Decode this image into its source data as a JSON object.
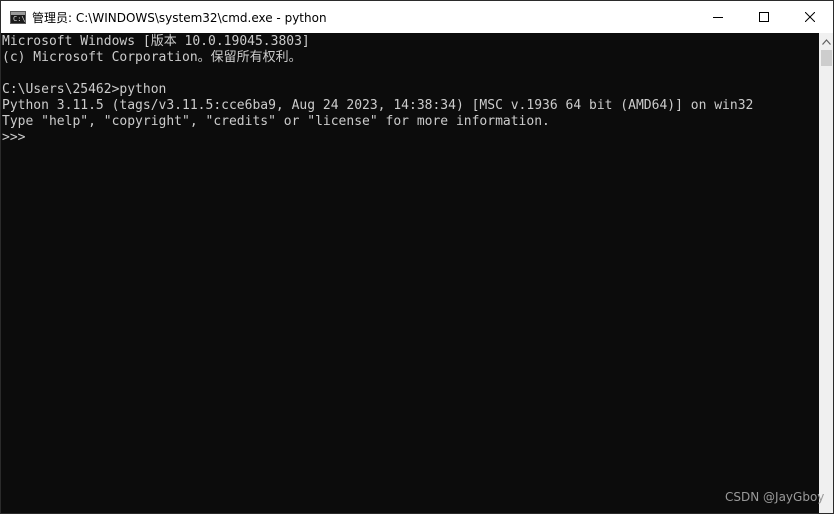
{
  "window": {
    "title": "管理员: C:\\WINDOWS\\system32\\cmd.exe - python",
    "icon_text": "C:\\",
    "controls": [
      "minimize-icon",
      "maximize-icon",
      "close-icon"
    ]
  },
  "console": {
    "lines": [
      "Microsoft Windows [版本 10.0.19045.3803]",
      "(c) Microsoft Corporation。保留所有权利。",
      "",
      "C:\\Users\\25462>python",
      "Python 3.11.5 (tags/v3.11.5:cce6ba9, Aug 24 2023, 14:38:34) [MSC v.1936 64 bit (AMD64)] on win32",
      "Type \"help\", \"copyright\", \"credits\" or \"license\" for more information.",
      ">>>"
    ]
  },
  "watermark": "CSDN @JayGboy",
  "colors": {
    "console_bg": "#0c0c0c",
    "console_text": "#cccccc",
    "titlebar_bg": "#ffffff",
    "scrollbar_bg": "#f0f0f0"
  }
}
